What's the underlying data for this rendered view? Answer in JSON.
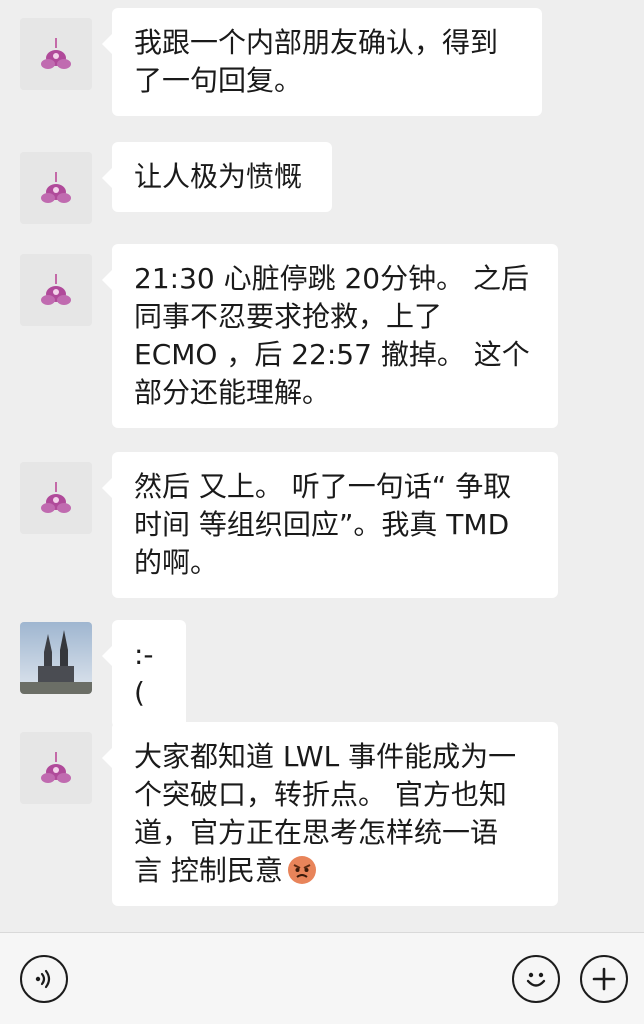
{
  "messages": [
    {
      "sender": "flower-avatar",
      "text": "我跟一个内部朋友确认，得到\n了一句回复。"
    },
    {
      "sender": "flower-avatar",
      "text": "让人极为愤慨"
    },
    {
      "sender": "flower-avatar",
      "text": "21:30 心脏停跳 20分钟。 之后\n同事不忍要求抢救，上了\nECMO ，后 22:57 撤掉。 这个\n部分还能理解。"
    },
    {
      "sender": "flower-avatar",
      "text": "然后 又上。 听了一句话“ 争取\n时间 等组织回应”。我真 TMD\n的啊。"
    },
    {
      "sender": "cathedral-avatar",
      "text": ":-("
    },
    {
      "sender": "flower-avatar",
      "text": "大家都知道 LWL 事件能成为一\n个突破口，转折点。 官方也知\n道，官方正在思考怎样统一语\n言 控制民意",
      "emoji": "angry-face-emoji"
    }
  ],
  "input_bar": {
    "voice_icon": "voice-icon",
    "emoji_icon": "smiley-icon",
    "plus_icon": "plus-icon"
  },
  "colors": {
    "background": "#eeeeee",
    "bubble": "#ffffff",
    "text": "#1a1a1a",
    "avatar_flower": "#b04a9a"
  }
}
